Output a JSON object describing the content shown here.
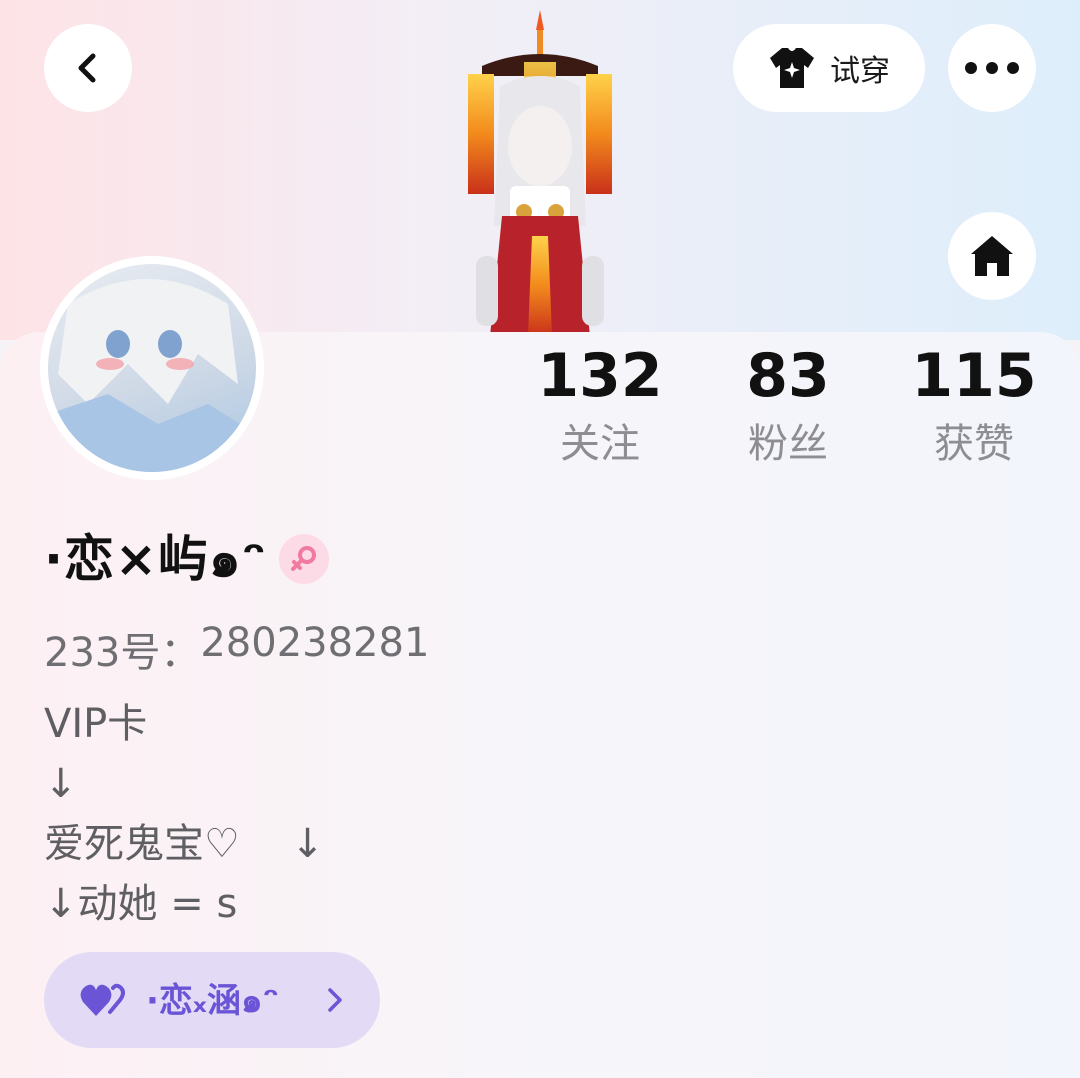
{
  "header": {
    "back_icon": "chevron-left-icon",
    "tryon_label": "试穿",
    "tryon_icon": "tshirt-star-icon",
    "more_icon": "more-dots-icon",
    "home_icon": "home-icon"
  },
  "stats": [
    {
      "value": "132",
      "label": "关注"
    },
    {
      "value": "83",
      "label": "粉丝"
    },
    {
      "value": "115",
      "label": "获赞"
    }
  ],
  "profile": {
    "username": "·恋×屿๑ᵔ",
    "gender_icon": "female-symbol-icon",
    "uid_label": "233号：",
    "uid_value": "280238281",
    "bio_lines": [
      "VIP卡",
      "↓",
      "爱死鬼宝♡    ↓",
      "↓动她 = s"
    ]
  },
  "friend_chip": {
    "icon": "double-heart-icon",
    "name": "·恋ₓ涵๑ᵔ",
    "arrow_icon": "chevron-right-icon"
  },
  "colors": {
    "accent_purple": "#6b55d6",
    "chip_bg": "#e3dbf6",
    "gender_pink": "#f07aa0"
  }
}
